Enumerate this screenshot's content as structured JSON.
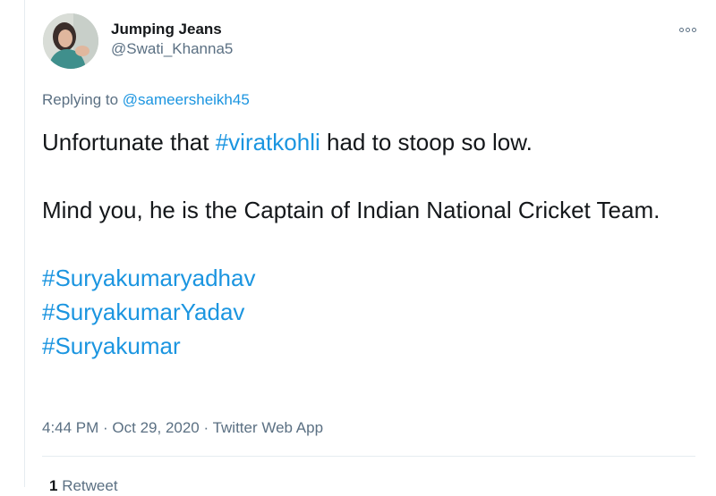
{
  "tweet": {
    "author": {
      "display_name": "Jumping Jeans",
      "handle": "@Swati_Khanna5"
    },
    "replying_prefix": "Replying to",
    "replying_to": "@sameersheikh45",
    "body": {
      "line1_pre": "Unfortunate that",
      "line1_hashtag": "#viratkohli",
      "line1_post": "had to stoop so low.",
      "para2": "Mind you, he is the Captain of Indian National Cricket Team.",
      "hashtags": [
        "#Suryakumaryadhav",
        "#SuryakumarYadav",
        "#Suryakumar"
      ]
    },
    "meta": {
      "time": "4:44 PM",
      "date": "Oct 29, 2020",
      "separator": " · ",
      "source": "Twitter Web App"
    },
    "stats": {
      "retweet_count": "1",
      "retweet_label": "Retweet"
    }
  },
  "colors": {
    "link": "#1b95e0",
    "secondary_text": "#5b7083",
    "primary_text": "#14171a",
    "divider": "#e6ecf0"
  },
  "icons": {
    "more": "more-options-icon"
  }
}
